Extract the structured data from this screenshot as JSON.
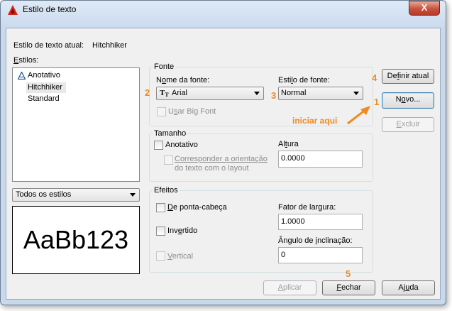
{
  "window": {
    "title": "Estilo de texto",
    "close_glyph": "X"
  },
  "current_style": {
    "label": "Estilo de texto atual:",
    "value": "Hitchhiker"
  },
  "styles": {
    "label": "Estilos:",
    "items": [
      {
        "icon": "annotative-icon",
        "label": "Anotativo"
      },
      {
        "label": "Hitchhiker"
      },
      {
        "label": "Standard"
      }
    ],
    "filter_value": "Todos os estilos"
  },
  "preview": {
    "text": "AaBb123"
  },
  "font": {
    "group_label": "Fonte",
    "name_label": "Nome da fonte:",
    "name_value": "Arial",
    "style_label": "Estilo de fonte:",
    "style_value": "Normal",
    "big_font_label": "Usar Big Font"
  },
  "size": {
    "group_label": "Tamanho",
    "annotative_label": "Anotativo",
    "match_orientation_line1": "Corresponder a orientação",
    "match_orientation_line2": "do texto com o layout",
    "height_label": "Altura",
    "height_value": "0.0000"
  },
  "effects": {
    "group_label": "Efeitos",
    "upside_down_label": "De ponta-cabeça",
    "backwards_label": "Invertido",
    "vertical_label": "Vertical",
    "width_factor_label": "Fator de largura:",
    "width_factor_value": "1.0000",
    "oblique_label": "Ângulo de inclinação:",
    "oblique_value": "0"
  },
  "buttons": {
    "set_current": "Definir atual",
    "new": "Novo...",
    "delete": "Excluir",
    "apply": "Aplicar",
    "close": "Fechar",
    "help": "Ajuda"
  },
  "annotations": {
    "n1": "1",
    "n2": "2",
    "n3": "3",
    "n4": "4",
    "n5": "5",
    "start_here": "iniciar aqui",
    "accent_color": "#f08a1f"
  }
}
